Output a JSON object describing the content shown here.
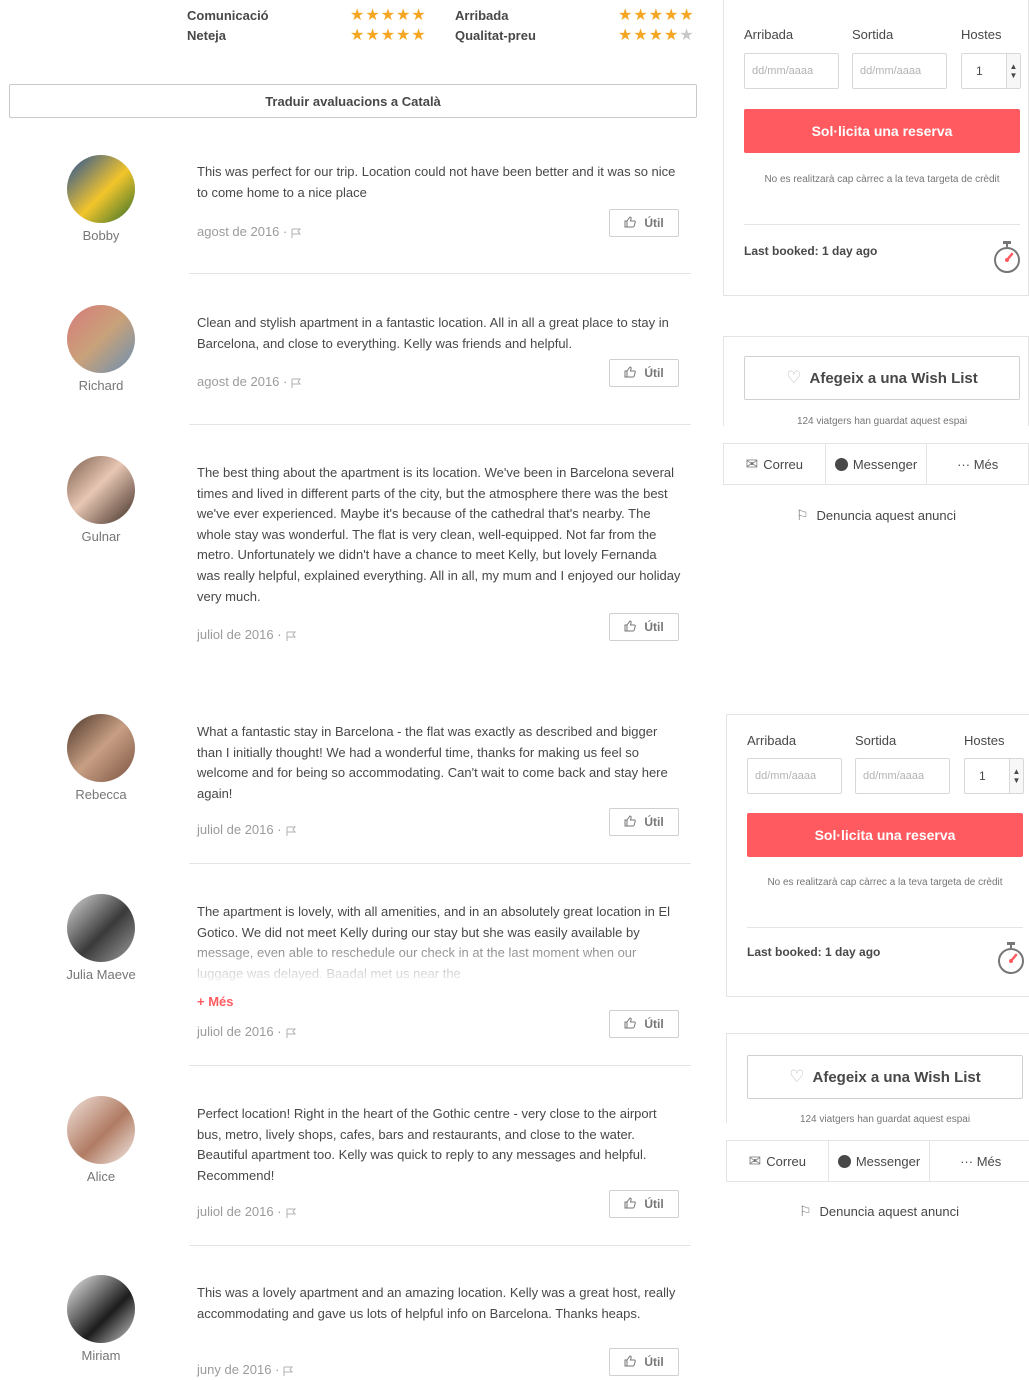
{
  "ratings": [
    {
      "label": "Comunicació",
      "stars": 5
    },
    {
      "label": "Neteja",
      "stars": 5
    },
    {
      "label": "Arribada",
      "stars": 5
    },
    {
      "label": "Qualitat-preu",
      "stars": 4.5
    }
  ],
  "translate_label": "Traduir avaluacions a Català",
  "useful_label": "Útil",
  "more_label": "+ Més",
  "reviews": [
    {
      "name": "Bobby",
      "text": "This was perfect for our trip. Location could not have been better and it was so nice to come home to a nice place",
      "date": "agost de 2016 ·"
    },
    {
      "name": "Richard",
      "text": "Clean and stylish apartment in a fantastic location. All in all a great place to stay in Barcelona, and close to everything. Kelly was friends and helpful.",
      "date": "agost de 2016 ·"
    },
    {
      "name": "Gulnar",
      "text": "The best thing about the apartment is its location. We've been in Barcelona several times and lived in different parts of the city, but the atmosphere there was the best we've ever experienced. Maybe it's because of the cathedral that's nearby. The whole stay was wonderful. The flat is very clean, well-equipped. Not far from the metro. Unfortunately we didn't have a chance to meet Kelly, but lovely Fernanda was really helpful, explained everything. All in all, my mum and I enjoyed our holiday very much.",
      "date": "juliol de 2016 ·"
    },
    {
      "name": "Rebecca",
      "text": "What a fantastic stay in Barcelona - the flat was exactly as described and bigger than I initially thought! We had a wonderful time, thanks for making us feel so welcome and for being so accommodating. Can't wait to come back and stay here again!",
      "date": "juliol de 2016 ·"
    },
    {
      "name": "Julia Maeve",
      "text": "The apartment is lovely, with all amenities, and in an absolutely great location in El Gotico. We did not meet Kelly during our stay but she was easily available by message, even able to reschedule our check in at the last moment when our luggage was delayed. Baadal met us near the",
      "date": "juliol de 2016 ·"
    },
    {
      "name": "Alice",
      "text": "Perfect location! Right in the heart of the Gothic centre - very close to the airport bus, metro, lively shops, cafes, bars and restaurants, and close to the water. Beautiful apartment too. Kelly was quick to reply to any messages and helpful. Recommend!",
      "date": "juliol de 2016 ·"
    },
    {
      "name": "Miriam",
      "text": "This was a lovely apartment and an amazing location. Kelly was a great host, really accommodating and gave us lots of helpful info on Barcelona. Thanks heaps.",
      "date": "juny de 2016 ·"
    }
  ],
  "booking": {
    "arrival_label": "Arribada",
    "departure_label": "Sortida",
    "guests_label": "Hostes",
    "date_placeholder": "dd/mm/aaaa",
    "guests_value": "1",
    "request_label": "Sol·licita una reserva",
    "no_charge": "No es realitzarà cap càrrec a la teva targeta de crèdit",
    "last_booked_prefix": "Last booked:",
    "last_booked_value": "1 day ago"
  },
  "wishlist": {
    "add_label": "Afegeix a una Wish List",
    "saved_count": "124 viatgers han guardat aquest espai"
  },
  "share": {
    "email": "Correu",
    "messenger": "Messenger",
    "more": "··· Més"
  },
  "report_label": "Denuncia aquest anunci",
  "colors": {
    "accent": "#ff5a5f",
    "star": "#f5a623",
    "text": "#484848"
  }
}
